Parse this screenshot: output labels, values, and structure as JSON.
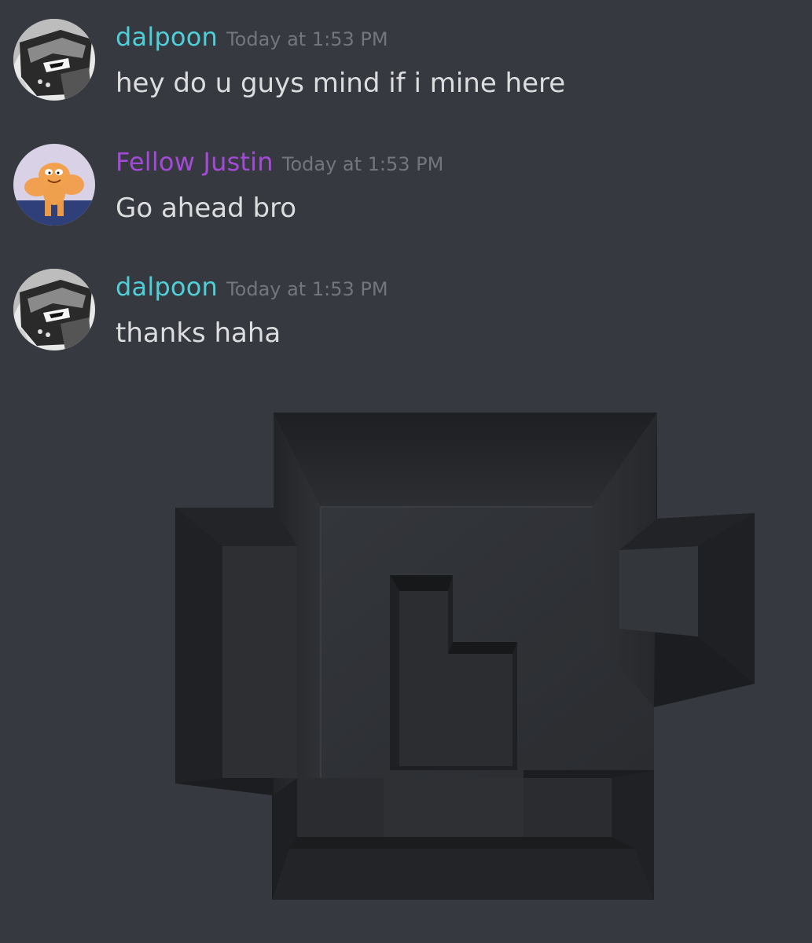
{
  "colors": {
    "background": "#36393f",
    "dalpoon_name": "#4fd0d9",
    "fellow_justin_name": "#a34bd6",
    "timestamp": "#72767d",
    "message_text": "#dcddde"
  },
  "messages": [
    {
      "author": "dalpoon",
      "author_color": "#4fd0d9",
      "avatar": "helmeted-knight-manga-avatar",
      "timestamp": "Today at 1:53 PM",
      "text": "hey do u guys mind if i mine here"
    },
    {
      "author": "Fellow Justin",
      "author_color": "#a34bd6",
      "avatar": "muscular-garfield-avatar",
      "timestamp": "Today at 1:53 PM",
      "text": "Go ahead bro"
    },
    {
      "author": "dalpoon",
      "author_color": "#4fd0d9",
      "avatar": "helmeted-knight-manga-avatar",
      "timestamp": "Today at 1:53 PM",
      "text": "thanks haha"
    }
  ],
  "attachment": {
    "icon": "discord-logo-shaped-mine-pit-image"
  }
}
